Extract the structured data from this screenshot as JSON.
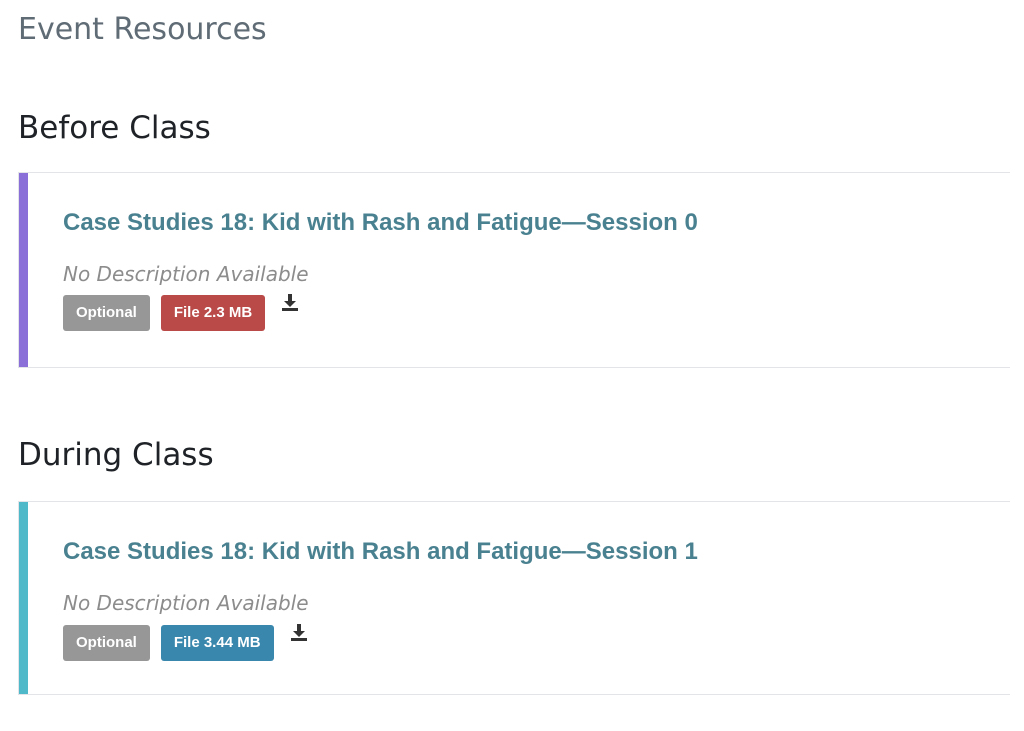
{
  "page": {
    "title": "Event Resources"
  },
  "sections": [
    {
      "heading": "Before Class",
      "accent_color": "#8b6fd9",
      "resource": {
        "title": "Case Studies 18: Kid with Rash and Fatigue—Session 0",
        "description": "No Description Available",
        "optional_label": "Optional",
        "file_label": "File 2.3 MB",
        "file_badge_color": "#b94a48",
        "download_icon": "download-icon"
      }
    },
    {
      "heading": "During Class",
      "accent_color": "#4fb8c9",
      "resource": {
        "title": "Case Studies 18: Kid with Rash and Fatigue—Session 1",
        "description": "No Description Available",
        "optional_label": "Optional",
        "file_label": "File 3.44 MB",
        "file_badge_color": "#3a87ad",
        "download_icon": "download-icon"
      }
    }
  ]
}
